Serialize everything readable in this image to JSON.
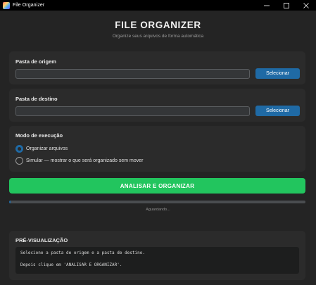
{
  "window": {
    "title": "File Organizer",
    "minimize_symbol": "—",
    "maximize_symbol": "☐",
    "close_symbol": "✕"
  },
  "header": {
    "title": "FILE ORGANIZER",
    "subtitle": "Organize seus arquivos de forma automática"
  },
  "source": {
    "label": "Pasta de origem",
    "value": "",
    "button_label": "Selecionar"
  },
  "destination": {
    "label": "Pasta de destino",
    "value": "",
    "button_label": "Selecionar"
  },
  "mode": {
    "label": "Modo de execução",
    "options": [
      {
        "label": "Organizar arquivos",
        "selected": true
      },
      {
        "label": "Simular — mostrar o que será organizado sem mover",
        "selected": false
      }
    ]
  },
  "action": {
    "button_label": "ANALISAR E ORGANIZAR"
  },
  "progress": {
    "value": 0.005,
    "status": "Aguardando..."
  },
  "preview": {
    "label": "PRÉ-VISUALIZAÇÃO",
    "lines": [
      "Selecione a pasta de origem e a pasta de destino.",
      "Depois clique em 'ANALISAR E ORGANIZAR'."
    ]
  },
  "colors": {
    "accent": "#1f6aa5",
    "primary_action": "#22c55e",
    "background": "#242424",
    "panel": "#2b2b2b"
  }
}
